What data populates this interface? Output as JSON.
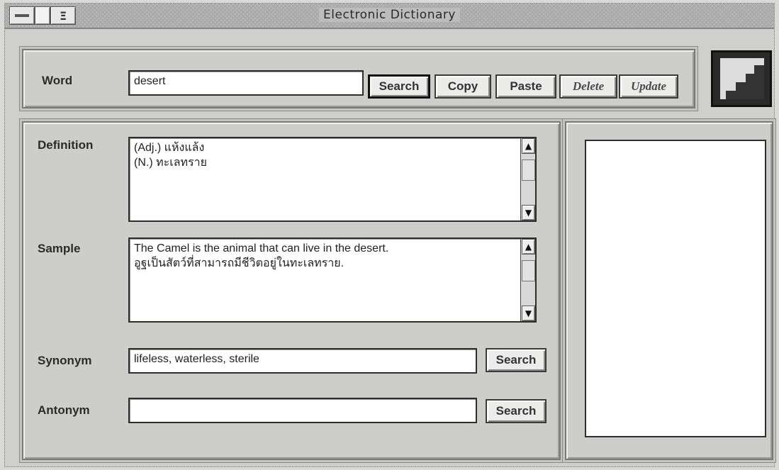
{
  "window": {
    "title": "Electronic Dictionary",
    "system_menu_icon": "system-menu-icon",
    "doc_icon_glyph": "Ξ"
  },
  "word": {
    "label": "Word",
    "value": "desert"
  },
  "toolbar": {
    "search_label": "Search",
    "copy_label": "Copy",
    "paste_label": "Paste",
    "delete_label": "Delete",
    "update_label": "Update"
  },
  "definition": {
    "label": "Definition",
    "value": "(Adj.) แห้งแล้ง\n(N.) ทะเลทราย"
  },
  "sample": {
    "label": "Sample",
    "value": "The Camel is the animal that can live in the desert.\nอูฐเป็นสัตว์ที่สามารถมีชีวิตอยู่ในทะเลทราย."
  },
  "synonym": {
    "label": "Synonym",
    "value": "lifeless, waterless, sterile",
    "search_label": "Search"
  },
  "antonym": {
    "label": "Antonym",
    "value": "",
    "search_label": "Search"
  },
  "icons": {
    "scroll_up": "▲",
    "scroll_down": "▼"
  }
}
